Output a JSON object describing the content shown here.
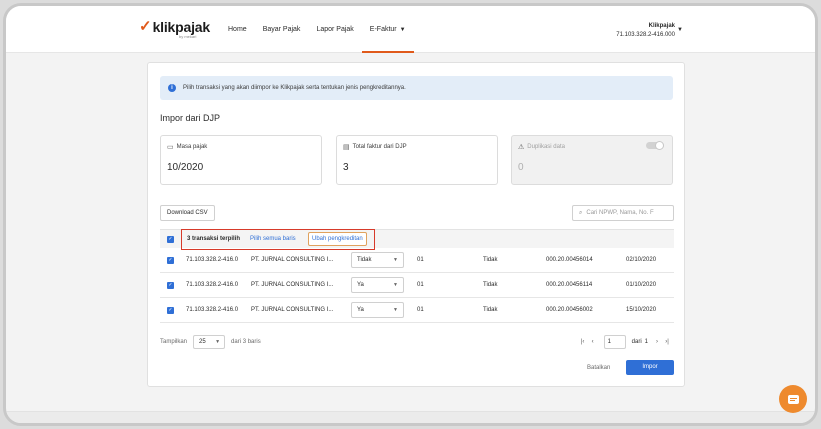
{
  "header": {
    "logo": "klikpajak",
    "logo_sub": "by mekari",
    "nav": [
      {
        "label": "Home",
        "active": false,
        "has_caret": false
      },
      {
        "label": "Bayar Pajak",
        "active": false,
        "has_caret": false
      },
      {
        "label": "Lapor Pajak",
        "active": false,
        "has_caret": false
      },
      {
        "label": "E-Faktur",
        "active": true,
        "has_caret": true
      }
    ],
    "user_name": "Klikpajak",
    "user_npwp": "71.103.328.2-416.000"
  },
  "info": {
    "icon": "info-icon",
    "text": "Pilih transaksi yang akan diimpor ke Klikpajak serta tentukan jenis pengkreditannya."
  },
  "page_title": "Impor dari DJP",
  "stats": [
    {
      "icon": "calendar-icon",
      "label": "Masa pajak",
      "value": "10/2020",
      "disabled": false
    },
    {
      "icon": "document-icon",
      "label": "Total faktur dari DJP",
      "value": "3",
      "disabled": false
    },
    {
      "icon": "warning-icon",
      "label": "Duplikasi data",
      "value": "0",
      "disabled": true
    }
  ],
  "toolbar": {
    "download_label": "Download CSV",
    "search_placeholder": "Cari NPWP, Nama, No. F"
  },
  "selection": {
    "count_label": "3 transaksi terpilih",
    "select_all_label": "Pilih semua baris",
    "change_credit_label": "Ubah pengkreditan"
  },
  "rows": [
    {
      "npwp": "71.103.328.2-416.0",
      "name": "PT. JURNAL CONSULTING I...",
      "credit": "Tidak",
      "code": "01",
      "status": "Tidak",
      "invoice": "000.20.00456014",
      "date": "02/10/2020"
    },
    {
      "npwp": "71.103.328.2-416.0",
      "name": "PT. JURNAL CONSULTING I...",
      "credit": "Ya",
      "code": "01",
      "status": "Tidak",
      "invoice": "000.20.00456114",
      "date": "01/10/2020"
    },
    {
      "npwp": "71.103.328.2-416.0",
      "name": "PT. JURNAL CONSULTING I...",
      "credit": "Ya",
      "code": "01",
      "status": "Tidak",
      "invoice": "000.20.00456002",
      "date": "15/10/2020"
    }
  ],
  "footer": {
    "show_label": "Tampilkan",
    "per_page": "25",
    "of_label": "dari 3 baris",
    "page": "1",
    "of_pages_label": "dari",
    "total_pages": "1"
  },
  "actions": {
    "cancel_label": "Batalkan",
    "import_label": "Impor"
  },
  "colors": {
    "accent": "#e05a1b",
    "primary": "#2f6fd6",
    "highlight_border": "#d73a2a",
    "chat": "#ee8a2e"
  }
}
